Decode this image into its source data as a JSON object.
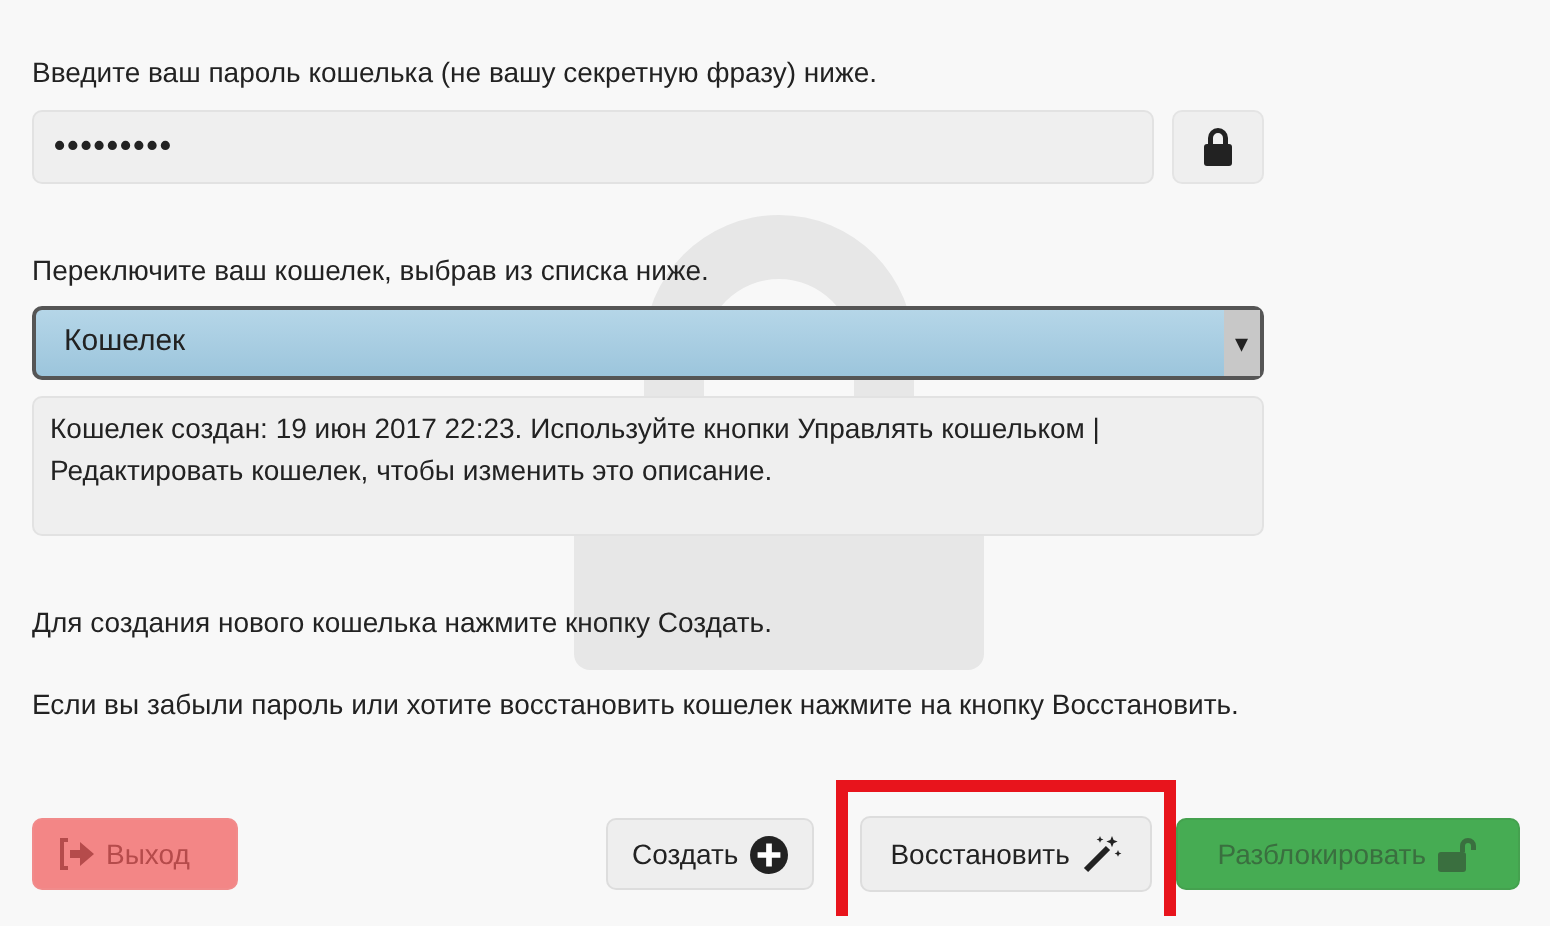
{
  "password": {
    "label": "Введите ваш пароль кошелька (не вашу секретную фразу) ниже.",
    "value": "•••••••••"
  },
  "wallet_select": {
    "label": "Переключите ваш кошелек, выбрав из списка ниже.",
    "value": "Кошелек",
    "arrow": "▾"
  },
  "description": "Кошелек создан: 19 июн 2017 22:23. Используйте кнопки Управлять кошельком | Редактировать кошелек, чтобы изменить это описание.",
  "hints": [
    "Для создания нового кошелька нажмите кнопку Создать.",
    "Если вы забыли пароль или хотите восстановить кошелек нажмите на кнопку Восстановить."
  ],
  "buttons": [
    {
      "kind": "exit",
      "label": "Выход",
      "disabled": true,
      "highlighted": false
    },
    {
      "kind": "create",
      "label": "Создать",
      "disabled": false,
      "highlighted": false
    },
    {
      "kind": "restore",
      "label": "Восстановить",
      "disabled": false,
      "highlighted": true
    },
    {
      "kind": "unlock",
      "label": "Разблокировать",
      "disabled": true,
      "highlighted": false
    }
  ]
}
